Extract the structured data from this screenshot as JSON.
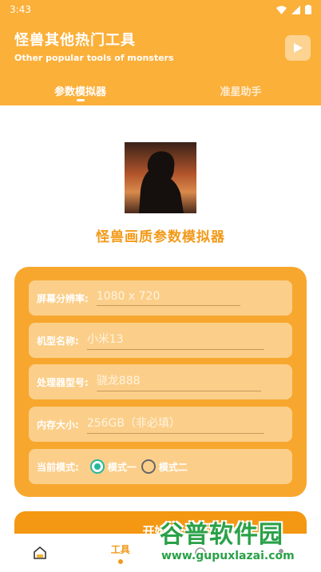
{
  "status": {
    "time": "3:43"
  },
  "header": {
    "title": "怪兽其他热门工具",
    "subtitle": "Other popular tools of monsters",
    "tabs": [
      {
        "label": "参数模拟器"
      },
      {
        "label": "准星助手"
      }
    ]
  },
  "app_title": "怪兽画质参数模拟器",
  "form": {
    "resolution": {
      "label": "屏幕分辨率:",
      "placeholder": "1080 x 720"
    },
    "model": {
      "label": "机型名称:",
      "placeholder": "小米13"
    },
    "processor": {
      "label": "处理器型号:",
      "placeholder": "骁龙888"
    },
    "memory": {
      "label": "内存大小:",
      "placeholder": "256GB（非必填）"
    },
    "mode": {
      "label": "当前模式:",
      "options": [
        {
          "label": "模式一"
        },
        {
          "label": "模式二"
        }
      ],
      "selected": "模式一"
    }
  },
  "start_button": {
    "label": "开始伪"
  },
  "bottom_nav": {
    "items": [
      {
        "label": ""
      },
      {
        "label": "工具"
      },
      {
        "label": ""
      },
      {
        "label": ""
      }
    ]
  },
  "watermark": {
    "line1": "谷普软件园",
    "line2": "www.gupuxlazai.com"
  },
  "colors": {
    "accent": "#fbb03a",
    "card": "#f8a72e",
    "row": "#fbcf8a",
    "radio": "#27b79b"
  }
}
